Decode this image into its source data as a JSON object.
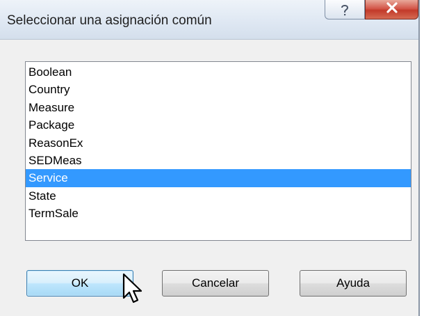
{
  "dialog": {
    "title": "Seleccionar una asignación común",
    "help_glyph": "?",
    "close_glyph": "X"
  },
  "list": {
    "items": [
      "Boolean",
      "Country",
      "Measure",
      "Package",
      "ReasonEx",
      "SEDMeas",
      "Service",
      "State",
      "TermSale"
    ],
    "selected": "Service"
  },
  "buttons": {
    "ok_label": "OK",
    "cancel_label": "Cancelar",
    "help_label": "Ayuda"
  },
  "colors": {
    "selection": "#3399ff",
    "close_button": "#c8483a",
    "default_button": "#bee6fd"
  },
  "icons": {
    "help": "question-mark",
    "close": "x-mark",
    "pointer": "arrow-cursor"
  }
}
